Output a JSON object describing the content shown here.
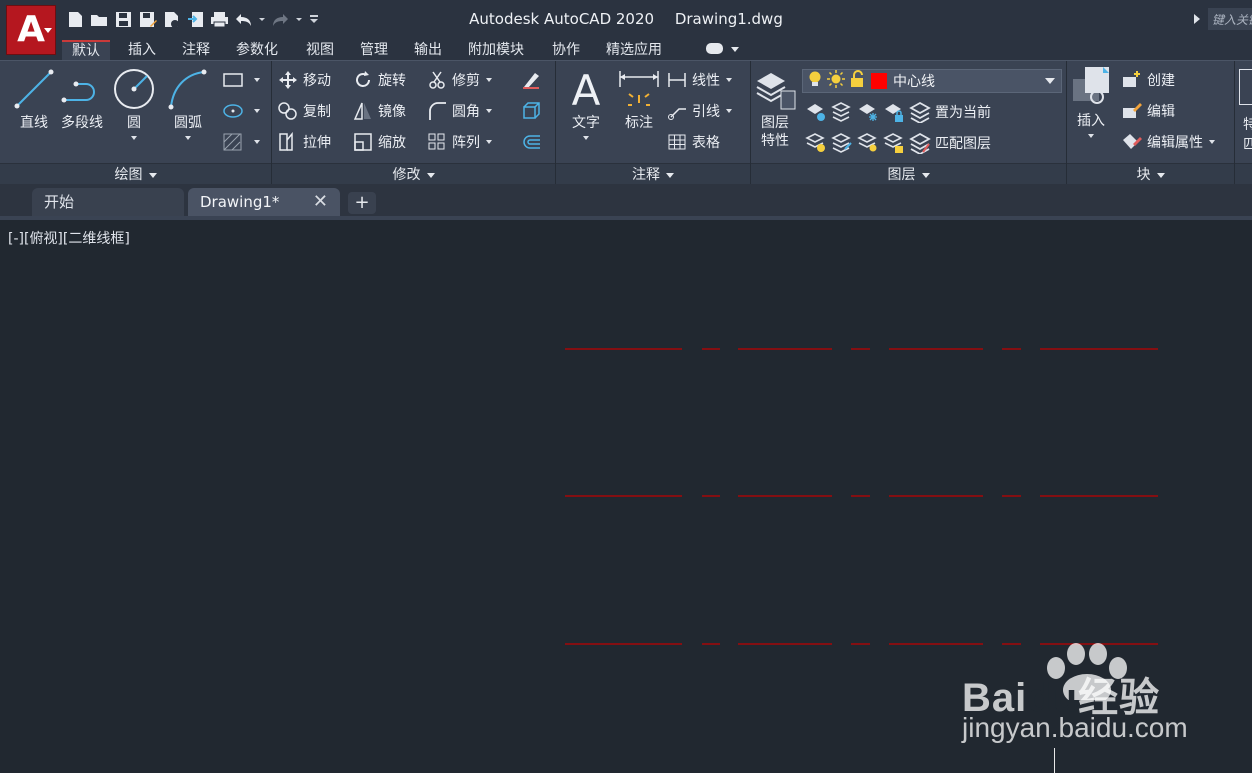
{
  "app": {
    "logo_letter": "A",
    "title": "Autodesk AutoCAD 2020",
    "document": "Drawing1.dwg",
    "search_placeholder": "键入关键字"
  },
  "ribbon_tabs": [
    "默认",
    "插入",
    "注释",
    "参数化",
    "视图",
    "管理",
    "输出",
    "附加模块",
    "协作",
    "精选应用"
  ],
  "active_tab": "默认",
  "panels": {
    "draw": {
      "title": "绘图",
      "tools": [
        "直线",
        "多段线",
        "圆",
        "圆弧"
      ]
    },
    "modify": {
      "title": "修改",
      "tools": [
        "移动",
        "旋转",
        "修剪",
        "复制",
        "镜像",
        "圆角",
        "拉伸",
        "缩放",
        "阵列"
      ]
    },
    "annotation": {
      "title": "注释",
      "tools": [
        "文字",
        "标注",
        "线性",
        "引线",
        "表格"
      ]
    },
    "layers": {
      "title": "图层",
      "properties_line1": "图层",
      "properties_line2": "特性",
      "current_layer": "中心线",
      "current_layer_color": "#ff0000",
      "set_current": "置为当前",
      "match_layer": "匹配图层"
    },
    "block": {
      "title": "块",
      "insert": "插入",
      "create": "创建",
      "edit": "编辑",
      "edit_attributes": "编辑属性"
    },
    "properties_partial": {
      "line1": "特",
      "line2": "匹"
    }
  },
  "doc_tabs": {
    "start": "开始",
    "drawing": "Drawing1*",
    "close_glyph": "✕",
    "add_glyph": "+"
  },
  "viewport": {
    "label": "[-][俯视][二维线框]"
  },
  "drawing": {
    "line_color": "#c00000",
    "centerlines": 3
  },
  "watermark": {
    "main_left": "Bai",
    "main_mid": "du",
    "main_right": "经验",
    "sub": "jingyan.baidu.com"
  }
}
